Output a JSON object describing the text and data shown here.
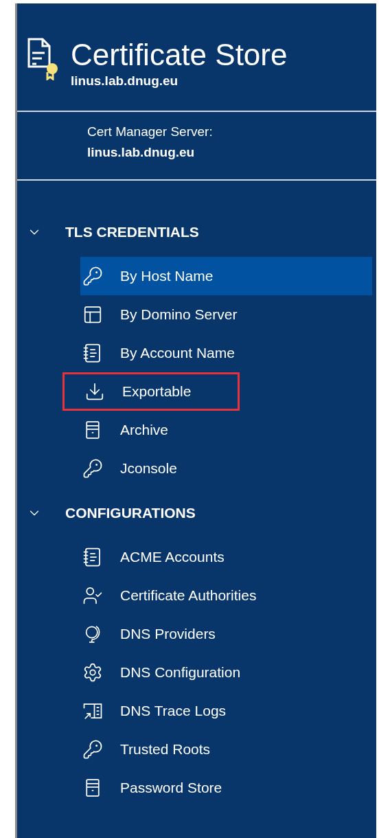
{
  "header": {
    "title": "Certificate Store",
    "subtitle": "linus.lab.dnug.eu"
  },
  "server": {
    "label": "Cert Manager Server:",
    "value": "linus.lab.dnug.eu"
  },
  "sections": [
    {
      "title": "TLS CREDENTIALS",
      "expanded": true,
      "items": [
        {
          "label": "By Host Name",
          "kind": "key",
          "selected": true,
          "highlighted": false
        },
        {
          "label": "By Domino Server",
          "kind": "layout",
          "selected": false,
          "highlighted": false
        },
        {
          "label": "By Account Name",
          "kind": "notebook",
          "selected": false,
          "highlighted": false
        },
        {
          "label": "Exportable",
          "kind": "download",
          "selected": false,
          "highlighted": true
        },
        {
          "label": "Archive",
          "kind": "cabinet",
          "selected": false,
          "highlighted": false
        },
        {
          "label": "Jconsole",
          "kind": "key",
          "selected": false,
          "highlighted": false
        }
      ]
    },
    {
      "title": "CONFIGURATIONS",
      "expanded": true,
      "items": [
        {
          "label": "ACME Accounts",
          "kind": "notebook",
          "selected": false,
          "highlighted": false
        },
        {
          "label": "Certificate Authorities",
          "kind": "user",
          "selected": false,
          "highlighted": false
        },
        {
          "label": "DNS Providers",
          "kind": "globe",
          "selected": false,
          "highlighted": false
        },
        {
          "label": "DNS Configuration",
          "kind": "gear",
          "selected": false,
          "highlighted": false
        },
        {
          "label": "DNS Trace Logs",
          "kind": "trace",
          "selected": false,
          "highlighted": false
        },
        {
          "label": "Trusted Roots",
          "kind": "key",
          "selected": false,
          "highlighted": false
        },
        {
          "label": "Password Store",
          "kind": "cabinet",
          "selected": false,
          "highlighted": false
        }
      ]
    }
  ]
}
